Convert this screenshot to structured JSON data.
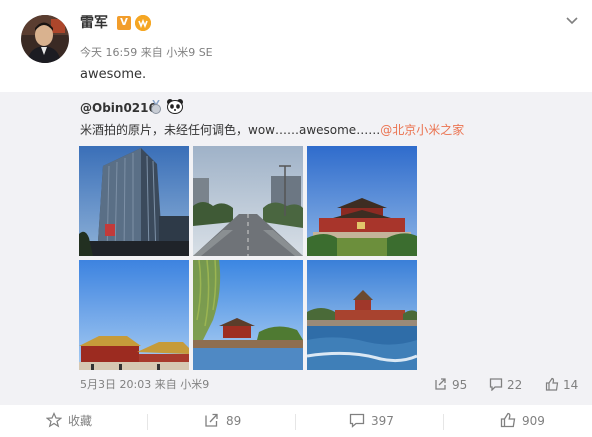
{
  "post": {
    "author": "雷军",
    "verified_badge": "V",
    "vip_badge": "vip",
    "time": "今天 16:59",
    "source_prefix": "来自",
    "source": "小米9 SE",
    "text": "awesome."
  },
  "repost": {
    "author": "@Obin0216",
    "text": "米酒拍的原片，未经任何调色，wow……awesome……",
    "mention": "@北京小米之家",
    "date": "5月3日 20:03",
    "source_prefix": "来自",
    "source": "小米9",
    "stats": {
      "reposts": "95",
      "comments": "22",
      "likes": "14"
    },
    "photos": [
      {
        "name": "photo-office-tower"
      },
      {
        "name": "photo-boulevard"
      },
      {
        "name": "photo-tiananmen"
      },
      {
        "name": "photo-forbidden-city-hall"
      },
      {
        "name": "photo-willow-gate"
      },
      {
        "name": "photo-corner-tower-moat"
      }
    ]
  },
  "actions": {
    "favorite": "收藏",
    "reposts": "89",
    "comments": "397",
    "likes": "909"
  },
  "icons": [
    "chevron-down-icon",
    "medal-icon",
    "panda-icon",
    "repost-icon",
    "comment-icon",
    "like-icon",
    "star-icon"
  ],
  "colors": {
    "link": "#eb7350",
    "muted": "#808080",
    "repost_bg": "#f2f2f5",
    "vip": "#f29d2b"
  }
}
